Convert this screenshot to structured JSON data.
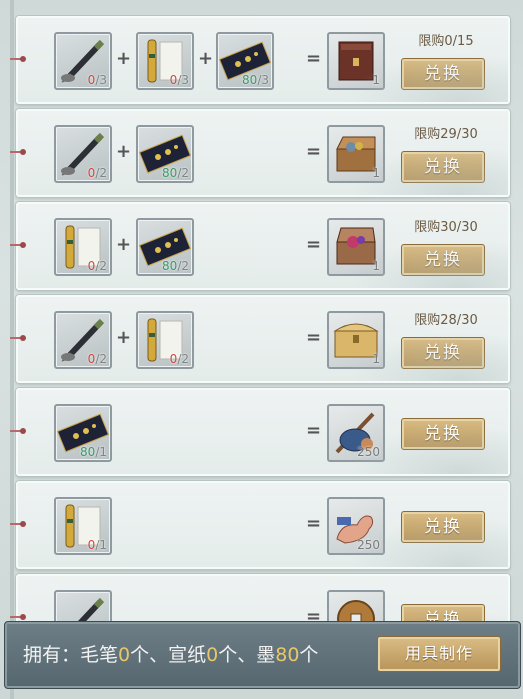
{
  "rows": [
    {
      "ingredients": [
        {
          "icon": "brush-icon",
          "have": "0",
          "need": "/3"
        },
        {
          "icon": "paper-scroll-icon",
          "have": "0",
          "need": "/3"
        },
        {
          "icon": "ink-stick-icon",
          "have": "80",
          "need": "/3"
        }
      ],
      "reward": {
        "icon": "lacquer-cabinet-icon",
        "count": "1"
      },
      "limit": "限购0/15",
      "button": "兑换"
    },
    {
      "ingredients": [
        {
          "icon": "brush-icon",
          "have": "0",
          "need": "/2"
        },
        {
          "icon": "ink-stick-icon",
          "have": "80",
          "need": "/2"
        }
      ],
      "reward": {
        "icon": "open-treasure-box-icon",
        "count": "1"
      },
      "limit": "限购29/30",
      "button": "兑换"
    },
    {
      "ingredients": [
        {
          "icon": "paper-scroll-icon",
          "have": "0",
          "need": "/2"
        },
        {
          "icon": "ink-stick-icon",
          "have": "80",
          "need": "/2"
        }
      ],
      "reward": {
        "icon": "gem-chest-icon",
        "count": "1"
      },
      "limit": "限购30/30",
      "button": "兑换"
    },
    {
      "ingredients": [
        {
          "icon": "brush-icon",
          "have": "0",
          "need": "/2"
        },
        {
          "icon": "paper-scroll-icon",
          "have": "0",
          "need": "/2"
        }
      ],
      "reward": {
        "icon": "golden-chest-icon",
        "count": "1"
      },
      "limit": "限购28/30",
      "button": "兑换"
    },
    {
      "ingredients": [
        {
          "icon": "ink-stick-icon",
          "have": "80",
          "need": "/1"
        }
      ],
      "reward": {
        "icon": "bindle-bag-icon",
        "count": "250"
      },
      "limit": "",
      "button": "兑换"
    },
    {
      "ingredients": [
        {
          "icon": "paper-scroll-icon",
          "have": "0",
          "need": "/1"
        }
      ],
      "reward": {
        "icon": "flexed-arm-icon",
        "count": "250"
      },
      "limit": "",
      "button": "兑换"
    },
    {
      "ingredients": [
        {
          "icon": "brush-icon",
          "have": "",
          "need": ""
        }
      ],
      "reward": {
        "icon": "copper-coin-icon",
        "count": ""
      },
      "limit": "",
      "button": "兑换"
    }
  ],
  "footer": {
    "owned_prefix": "拥有：毛笔",
    "brush_count": "0",
    "sep1": "个、宣纸",
    "paper_count": "0",
    "sep2": "个、墨",
    "ink_count": "80",
    "suffix": "个",
    "craft_button": "用具制作"
  },
  "colors": {
    "have_zero": "#d0473e",
    "have_enough": "#3b9a6a",
    "button_gold": "#c9a66b",
    "footer_bg": "#5f7079"
  }
}
